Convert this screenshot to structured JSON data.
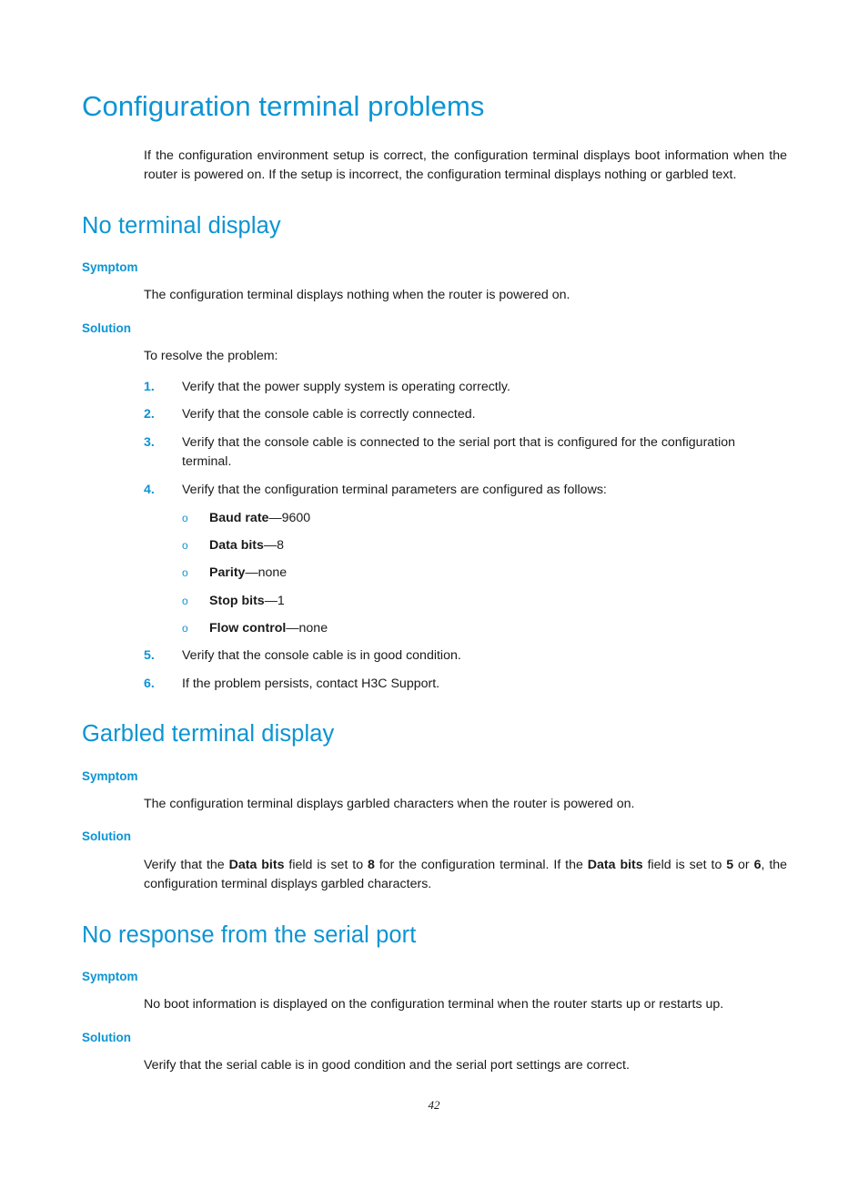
{
  "document": {
    "page_number": "42",
    "accent_color": "#0c94d4",
    "body_color": "#1a1a1a"
  },
  "title": "Configuration terminal problems",
  "intro": "If the configuration environment setup is correct, the configuration terminal displays boot information when the router is powered on. If the setup is incorrect, the configuration terminal displays nothing or garbled text.",
  "sections": [
    {
      "heading": "No terminal display",
      "symptom_label": "Symptom",
      "symptom_text": "The configuration terminal displays nothing when the router is powered on.",
      "solution_label": "Solution",
      "solution_intro": "To resolve the problem:",
      "steps": [
        {
          "num": "1.",
          "text": "Verify that the power supply system is operating correctly."
        },
        {
          "num": "2.",
          "text": "Verify that the console cable is correctly connected."
        },
        {
          "num": "3.",
          "text": "Verify that the console cable is connected to the serial port that is configured for the configuration terminal."
        },
        {
          "num": "4.",
          "text": "Verify that the configuration terminal parameters are configured as follows:"
        },
        {
          "num": "5.",
          "text": "Verify that the console cable is in good condition."
        },
        {
          "num": "6.",
          "text": "If the problem persists, contact H3C Support."
        }
      ],
      "parameters": [
        {
          "marker": "o",
          "label": "Baud rate",
          "dash": "—",
          "value": "9600"
        },
        {
          "marker": "o",
          "label": "Data bits",
          "dash": "—",
          "value": "8"
        },
        {
          "marker": "o",
          "label": "Parity",
          "dash": "—",
          "value": "none"
        },
        {
          "marker": "o",
          "label": "Stop bits",
          "dash": "—",
          "value": "1"
        },
        {
          "marker": "o",
          "label": "Flow control",
          "dash": "—",
          "value": "none"
        }
      ]
    },
    {
      "heading": "Garbled terminal display",
      "symptom_label": "Symptom",
      "symptom_text": "The configuration terminal displays garbled characters when the router is powered on.",
      "solution_label": "Solution",
      "solution_parts": {
        "p1": "Verify that the ",
        "b1": "Data bits",
        "p2": " field is set to ",
        "b2": "8",
        "p3": " for the configuration terminal. If the ",
        "b3": "Data bits",
        "p4": " field is set to ",
        "b4": "5",
        "p5": " or ",
        "b5": "6",
        "p6": ", the configuration terminal displays garbled characters."
      }
    },
    {
      "heading": "No response from the serial port",
      "symptom_label": "Symptom",
      "symptom_text": "No boot information is displayed on the configuration terminal when the router starts up or restarts up.",
      "solution_label": "Solution",
      "solution_text": "Verify that the serial cable is in good condition and the serial port settings are correct."
    }
  ]
}
